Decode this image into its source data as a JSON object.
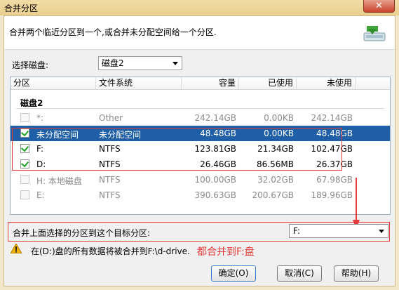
{
  "window": {
    "title": "合并分区",
    "close_icon": "✕"
  },
  "header": {
    "description": "合并两个临近分区到一个,或合并未分配空间给一个分区.",
    "icon": "merge-partition-icon"
  },
  "disk_select": {
    "label": "选择磁盘:",
    "value": "磁盘2"
  },
  "table": {
    "headers": [
      "分区",
      "文件系统",
      "容量",
      "已使用",
      "未使用"
    ],
    "group_label": "磁盘2",
    "rows": [
      {
        "name": "*:",
        "fs": "Other",
        "capacity": "242.14GB",
        "used": "0.00KB",
        "free": "242.14GB",
        "checked": false,
        "disabled": true,
        "selected": false
      },
      {
        "name": "未分配空间",
        "fs": "未分配空间",
        "capacity": "48.48GB",
        "used": "0.00KB",
        "free": "48.48GB",
        "checked": true,
        "disabled": false,
        "selected": true
      },
      {
        "name": "F:",
        "fs": "NTFS",
        "capacity": "123.81GB",
        "used": "21.34GB",
        "free": "102.47GB",
        "checked": true,
        "disabled": false,
        "selected": false
      },
      {
        "name": "D:",
        "fs": "NTFS",
        "capacity": "26.46GB",
        "used": "86.56MB",
        "free": "26.37GB",
        "checked": true,
        "disabled": false,
        "selected": false
      },
      {
        "name": "H: 本地磁盘",
        "fs": "NTFS",
        "capacity": "100.00GB",
        "used": "32.02GB",
        "free": "67.98GB",
        "checked": false,
        "disabled": true,
        "selected": false
      },
      {
        "name": "E:",
        "fs": "NTFS",
        "capacity": "390.63GB",
        "used": "200.67GB",
        "free": "189.96GB",
        "checked": false,
        "disabled": true,
        "selected": false
      }
    ]
  },
  "target": {
    "label": "合并上面选择的分区到这个目标分区:",
    "value": "F:"
  },
  "warning": {
    "text": "在(D:)盘的所有数据将被合并到F:\\d-drive."
  },
  "annotation": {
    "text": "都合并到F:盘"
  },
  "buttons": {
    "ok": "确定(O)",
    "cancel": "取消(C)",
    "help": "帮助(H)"
  },
  "colors": {
    "selection": "#1e5fa8",
    "annotation_red": "#e43b3b",
    "check_green": "#22a32a"
  }
}
